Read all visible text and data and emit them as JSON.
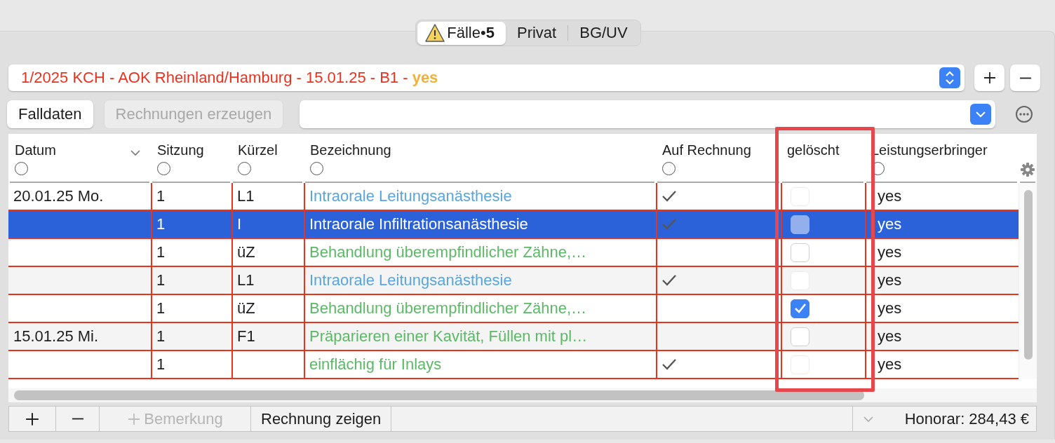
{
  "tabs": [
    {
      "label": "Fälle•**5**",
      "selected": true,
      "warning": true
    },
    {
      "label": "Privat",
      "selected": false,
      "warning": false
    },
    {
      "label": "BG/UV",
      "selected": false,
      "warning": false
    }
  ],
  "case_select": {
    "value": "1/2025 KCH - AOK Rheinland/Hamburg - 15.01.25 - B1 -",
    "suffix": "yes"
  },
  "toolbar": {
    "buttons": [
      {
        "label": "Falldaten",
        "disabled": false
      },
      {
        "label": "Rechnungen erzeugen",
        "disabled": true
      }
    ]
  },
  "table": {
    "columns": [
      {
        "label": "Datum",
        "sorted": true,
        "filter": true
      },
      {
        "label": "Sitzung",
        "sorted": false,
        "filter": true
      },
      {
        "label": "Kürzel",
        "sorted": false,
        "filter": true
      },
      {
        "label": "Bezeichnung",
        "sorted": false,
        "filter": true
      },
      {
        "label": "Auf Rechnung",
        "sorted": false,
        "filter": true
      },
      {
        "label": "gelöscht",
        "sorted": false,
        "filter": false
      },
      {
        "label": "Leistungserbringer",
        "sorted": false,
        "filter": true
      }
    ],
    "rows": [
      {
        "date": "20.01.25  Mo.",
        "session": "1",
        "code": "L1",
        "description": "Intraorale Leitungsanästhesie",
        "color": "#5aa5dc",
        "billed": true,
        "deleted": false,
        "deleted_disabled": true,
        "provider": "yes",
        "selected": false
      },
      {
        "session": "1",
        "code": "I",
        "description": "Intraorale Infiltrationsanästhesie",
        "billed": true,
        "deleted": false,
        "deleted_disabled": true,
        "provider": "yes",
        "selected": true
      },
      {
        "session": "1",
        "code": "üZ",
        "description": "Behandlung überempfindlicher Zähne,…",
        "color": "#5cb866",
        "billed": false,
        "deleted": false,
        "deleted_disabled": false,
        "provider": "yes",
        "selected": false
      },
      {
        "session": "1",
        "code": "L1",
        "description": "Intraorale Leitungsanästhesie",
        "color": "#5aa5dc",
        "billed": true,
        "deleted": false,
        "deleted_disabled": true,
        "provider": "yes",
        "selected": false
      },
      {
        "session": "1",
        "code": "üZ",
        "description": "Behandlung überempfindlicher Zähne,…",
        "color": "#5cb866",
        "billed": false,
        "deleted": true,
        "deleted_disabled": false,
        "provider": "yes",
        "selected": false
      },
      {
        "date": "15.01.25  Mi.",
        "session": "1",
        "code": "F1",
        "description": "Präparieren einer Kavität, Füllen mit pl…",
        "color": "#5cb866",
        "billed": false,
        "deleted": false,
        "deleted_disabled": false,
        "provider": "yes",
        "selected": false
      },
      {
        "session": "1",
        "description": "einflächig für Inlays",
        "color": "#5cb866",
        "billed": true,
        "deleted": false,
        "deleted_disabled": true,
        "provider": "yes",
        "selected": false
      }
    ]
  },
  "footer": {
    "buttons": [
      {
        "kind": "plus",
        "disabled": false
      },
      {
        "kind": "minus",
        "disabled": false
      },
      {
        "kind": "add-text",
        "label": "Bemerkung",
        "disabled": true
      },
      {
        "kind": "text",
        "label": "Rechnung zeigen",
        "disabled": false
      }
    ],
    "total": "Honorar: 284,43 €"
  }
}
